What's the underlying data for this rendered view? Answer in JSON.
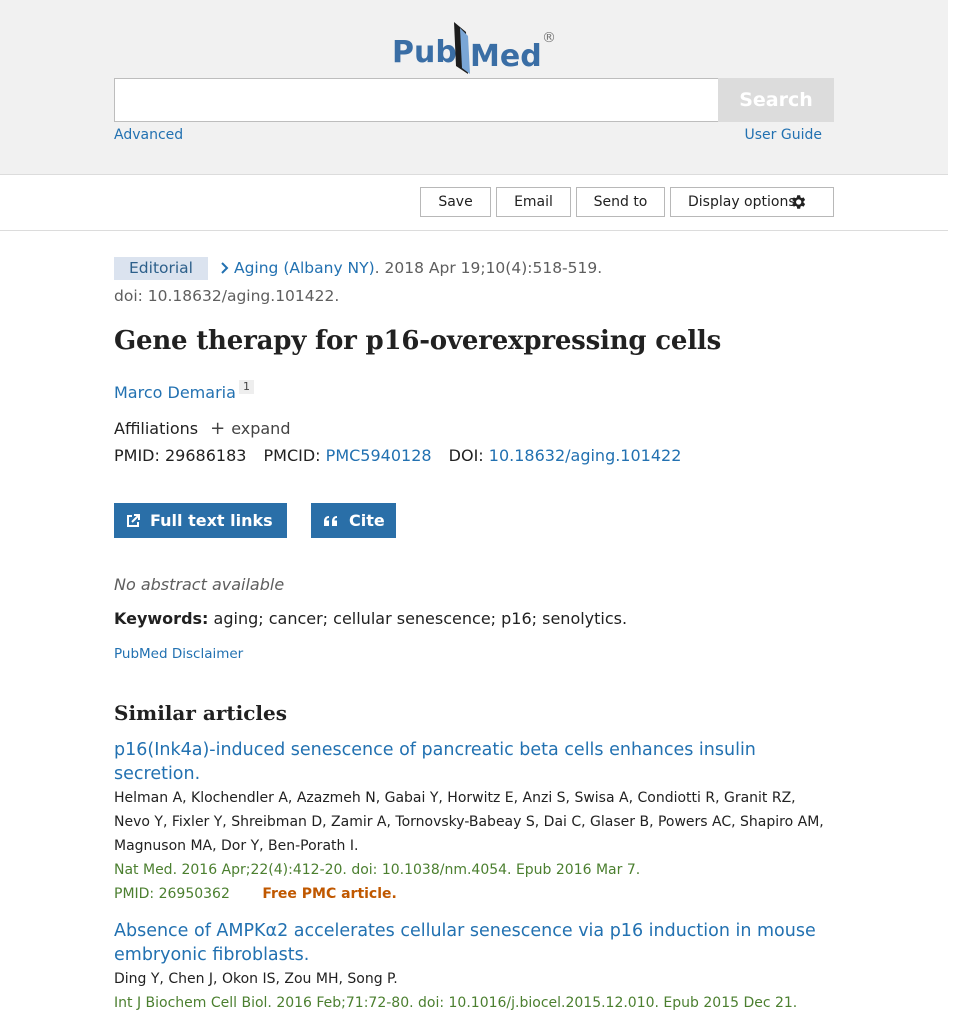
{
  "header": {
    "logo_text_left": "Pub",
    "logo_text_right": "Med",
    "logo_reg": "®",
    "search": {
      "value": "",
      "placeholder": "",
      "button_label": "Search"
    },
    "advanced_label": "Advanced",
    "user_guide_label": "User Guide"
  },
  "actions": {
    "save": "Save",
    "email": "Email",
    "send_to": "Send to",
    "display_options": "Display options",
    "display_icon": "gear-icon"
  },
  "article": {
    "type_badge": "Editorial",
    "journal": "Aging (Albany NY)",
    "citation": ". 2018 Apr 19;10(4):518-519.",
    "doi_line": "doi: 10.18632/aging.101422.",
    "title": "Gene therapy for p16-overexpressing cells",
    "author": "Marco Demaria",
    "author_sup": "1",
    "affiliations_label": "Affiliations",
    "expand_label": "expand",
    "pmid_label": "PMID:",
    "pmid": "29686183",
    "pmcid_label": "PMCID:",
    "pmcid": "PMC5940128",
    "doi_label": "DOI:",
    "doi": "10.18632/aging.101422",
    "full_text_label": "Full text links",
    "cite_label": "Cite",
    "no_abstract": "No abstract available",
    "keywords_label": "Keywords:",
    "keywords": "aging; cancer; cellular senescence; p16; senolytics.",
    "disclaimer": "PubMed Disclaimer"
  },
  "similar": {
    "heading": "Similar articles",
    "items": [
      {
        "title": "p16(Ink4a)-induced senescence of pancreatic beta cells enhances insulin secretion.",
        "authors": "Helman A, Klochendler A, Azazmeh N, Gabai Y, Horwitz E, Anzi S, Swisa A, Condiotti R, Granit RZ, Nevo Y, Fixler Y, Shreibman D, Zamir A, Tornovsky-Babeay S, Dai C, Glaser B, Powers AC, Shapiro AM, Magnuson MA, Dor Y, Ben-Porath I.",
        "source": "Nat Med. 2016 Apr;22(4):412-20. doi: 10.1038/nm.4054. Epub 2016 Mar 7.",
        "pmid": "PMID: 26950362",
        "free": "Free PMC article."
      },
      {
        "title": "Absence of AMPKα2 accelerates cellular senescence via p16 induction in mouse embryonic fibroblasts.",
        "authors": "Ding Y, Chen J, Okon IS, Zou MH, Song P.",
        "source": "Int J Biochem Cell Biol. 2016 Feb;71:72-80. doi: 10.1016/j.biocel.2015.12.010. Epub 2015 Dec 21."
      }
    ]
  },
  "colors": {
    "link": "#2271b1",
    "button": "#2a6fa8",
    "source_green": "#4b7f2f",
    "free_orange": "#c05800"
  }
}
